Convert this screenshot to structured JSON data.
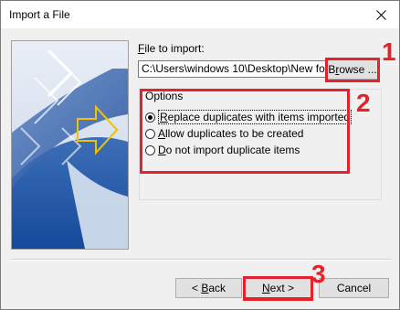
{
  "window": {
    "title": "Import a File"
  },
  "file": {
    "label_accel": "F",
    "label_rest": "ile to import:",
    "value": "C:\\Users\\windows 10\\Desktop\\New fo",
    "browse_accel": "r",
    "browse_pre": "B",
    "browse_rest": "owse ..."
  },
  "options": {
    "title": "Options",
    "items": [
      {
        "accel": "R",
        "rest": "eplace duplicates with items imported",
        "selected": true
      },
      {
        "accel": "A",
        "rest": "llow duplicates to be created",
        "selected": false
      },
      {
        "accel": "D",
        "rest": "o not import duplicate items",
        "selected": false
      }
    ]
  },
  "buttons": {
    "back_pre": "< ",
    "back_accel": "B",
    "back_rest": "ack",
    "next_accel": "N",
    "next_rest": "ext >",
    "cancel": "Cancel"
  },
  "annotations": {
    "badge1": "1",
    "badge2": "2",
    "badge3": "3",
    "color": "#e8202a"
  },
  "icons": [
    "close-icon",
    "import-wizard-art"
  ]
}
